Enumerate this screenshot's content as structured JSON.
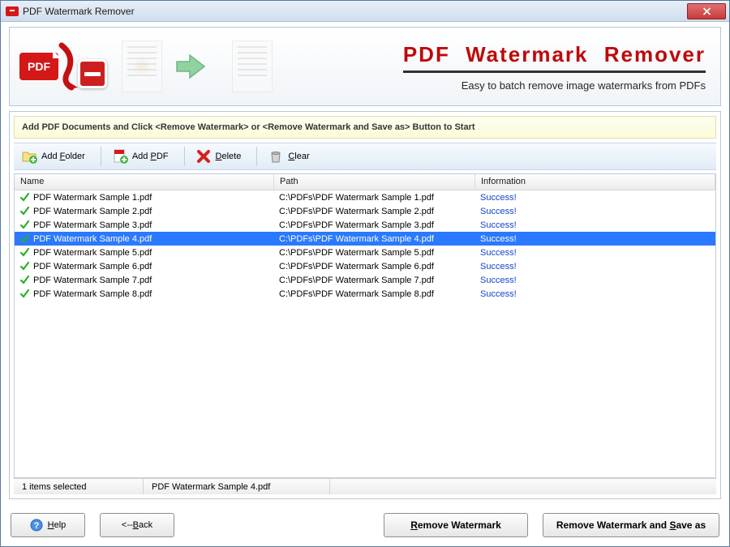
{
  "window": {
    "title": "PDF Watermark Remover"
  },
  "banner": {
    "logo_text": "PDF",
    "title": "PDF  Watermark  Remover",
    "subtitle": "Easy to batch remove image watermarks from PDFs"
  },
  "instruction": "Add PDF Documents and Click <Remove Watermark> or <Remove Watermark and Save as> Button to Start",
  "toolbar": {
    "add_folder": "Add Folder",
    "add_pdf": "Add PDF",
    "delete": "Delete",
    "clear": "Clear"
  },
  "columns": {
    "name": "Name",
    "path": "Path",
    "info": "Information"
  },
  "rows": [
    {
      "name": "PDF Watermark Sample 1.pdf",
      "path": "C:\\PDFs\\PDF Watermark Sample 1.pdf",
      "info": "Success!",
      "selected": false
    },
    {
      "name": "PDF Watermark Sample 2.pdf",
      "path": "C:\\PDFs\\PDF Watermark Sample 2.pdf",
      "info": "Success!",
      "selected": false
    },
    {
      "name": "PDF Watermark Sample 3.pdf",
      "path": "C:\\PDFs\\PDF Watermark Sample 3.pdf",
      "info": "Success!",
      "selected": false
    },
    {
      "name": "PDF Watermark Sample 4.pdf",
      "path": "C:\\PDFs\\PDF Watermark Sample 4.pdf",
      "info": "Success!",
      "selected": true
    },
    {
      "name": "PDF Watermark Sample 5.pdf",
      "path": "C:\\PDFs\\PDF Watermark Sample 5.pdf",
      "info": "Success!",
      "selected": false
    },
    {
      "name": "PDF Watermark Sample 6.pdf",
      "path": "C:\\PDFs\\PDF Watermark Sample 6.pdf",
      "info": "Success!",
      "selected": false
    },
    {
      "name": "PDF Watermark Sample 7.pdf",
      "path": "C:\\PDFs\\PDF Watermark Sample 7.pdf",
      "info": "Success!",
      "selected": false
    },
    {
      "name": "PDF Watermark Sample 8.pdf",
      "path": "C:\\PDFs\\PDF Watermark Sample 8.pdf",
      "info": "Success!",
      "selected": false
    }
  ],
  "status": {
    "selection": "1 items selected",
    "file": "PDF Watermark Sample 4.pdf"
  },
  "footer": {
    "help": "Help",
    "back": "<--Back",
    "remove": "Remove Watermark",
    "remove_save": "Remove Watermark and Save as"
  }
}
